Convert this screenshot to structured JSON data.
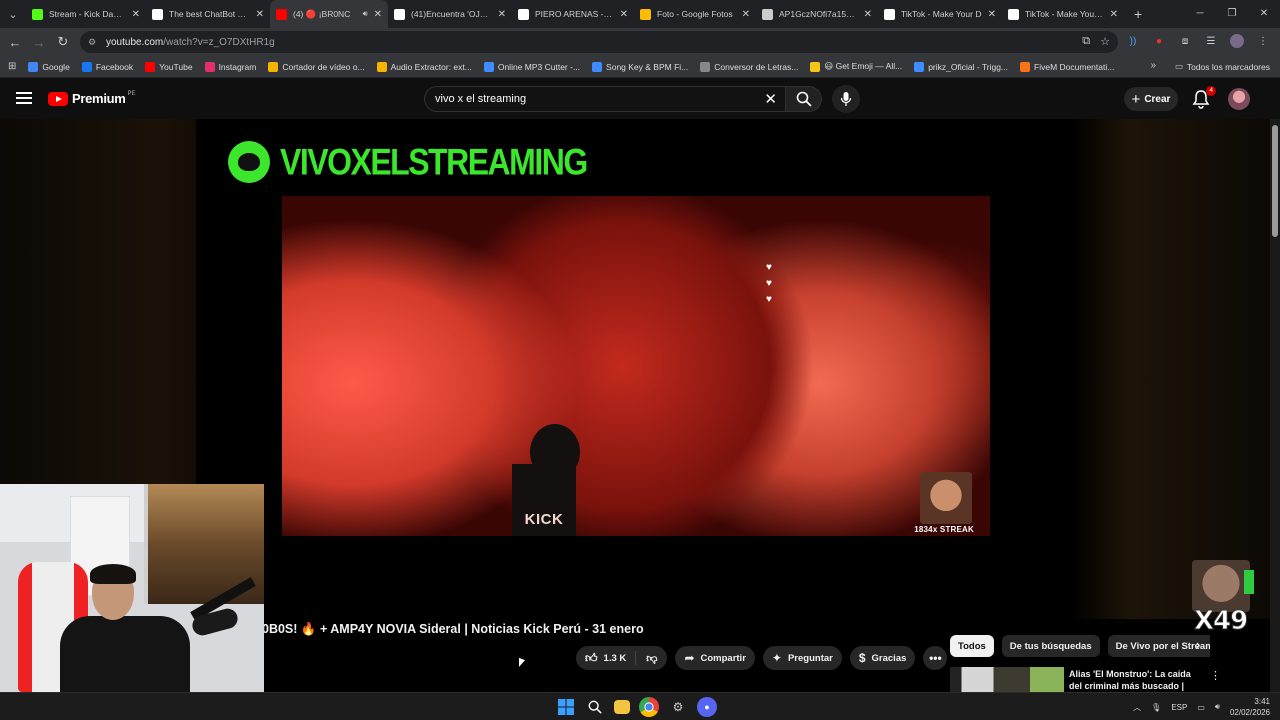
{
  "browser": {
    "tabs": [
      {
        "title": "Stream - Kick Dashboard",
        "icon": "kick-icon",
        "color": "#53fc18"
      },
      {
        "title": "The best ChatBot and",
        "icon": "chatbot-icon",
        "color": "#ffffff"
      },
      {
        "title": "(4) 🔴 ¡BR0NC",
        "icon": "youtube-icon",
        "color": "#ff0000",
        "active": true,
        "audio": true
      },
      {
        "title": "(41)Encuentra 'OJERA",
        "icon": "tiktok-icon",
        "color": "#ffffff"
      },
      {
        "title": "PIERO ARENAS - Bus",
        "icon": "google-icon",
        "color": "#ffffff"
      },
      {
        "title": "Foto - Google Fotos",
        "icon": "google-photos-icon",
        "color": "#fbbc05"
      },
      {
        "title": "AP1GczNOfi7a15uW",
        "icon": "globe-icon",
        "color": "#cccccc"
      },
      {
        "title": "TikTok - Make Your D",
        "icon": "tiktok-icon",
        "color": "#ffffff"
      },
      {
        "title": "TikTok - Make Your D",
        "icon": "tiktok-icon",
        "color": "#ffffff"
      }
    ],
    "url_host": "youtube.com",
    "url_path": "/watch?v=z_O7DXtHR1g",
    "bookmarks": [
      {
        "label": "Google",
        "icon": "google-icon",
        "color": "#4285f4"
      },
      {
        "label": "Facebook",
        "icon": "facebook-icon",
        "color": "#1877f2"
      },
      {
        "label": "YouTube",
        "icon": "youtube-icon",
        "color": "#ff0000"
      },
      {
        "label": "Instagram",
        "icon": "instagram-icon",
        "color": "#e1306c"
      },
      {
        "label": "Cortador de vídeo o...",
        "icon": "scissors-icon",
        "color": "#f4b400"
      },
      {
        "label": "Audio Extractor: ext...",
        "icon": "audio-icon",
        "color": "#f4b400"
      },
      {
        "label": "Online MP3 Cutter -...",
        "icon": "mp3-icon",
        "color": "#3f8cff"
      },
      {
        "label": "Song Key & BPM Fi...",
        "icon": "music-icon",
        "color": "#3f8cff"
      },
      {
        "label": "Conversor de Letras...",
        "icon": "text-icon",
        "color": "#888888"
      },
      {
        "label": "😃 Get Emoji — All...",
        "icon": "emoji-icon",
        "color": "#f5c518"
      },
      {
        "label": "prikz_Oficial - Trigg...",
        "icon": "trigger-icon",
        "color": "#3f8cff"
      },
      {
        "label": "FiveM Documentati...",
        "icon": "fivem-icon",
        "color": "#f97316"
      }
    ],
    "bookmarks_all": "Todos los marcadores"
  },
  "youtube": {
    "logo_text": "Premium",
    "country_code": "PE",
    "search_query": "vivo x el streaming",
    "create_label": "Crear",
    "notifications_count": "4",
    "channel_name_in_video": "VIVOXELSTREAMING",
    "mic_flag_text": "KICK",
    "streak_text": "1834x STREAK",
    "video_title": "0B0S! 🔥 + AMP4Y NOVIA Sideral | Noticias Kick Perú - 31 enero",
    "likes": "1.3 K",
    "share_label": "Compartir",
    "ask_label": "Preguntar",
    "thanks_label": "Gracias",
    "chips": [
      {
        "label": "Todos",
        "active": true
      },
      {
        "label": "De tus búsquedas",
        "active": false
      },
      {
        "label": "De Vivo por el Streaming",
        "active": false
      }
    ],
    "recommendation_title": "Alias 'El Monstruo': La caída del criminal más buscado | Cuarto"
  },
  "overlay": {
    "reaction_multiplier": "X49"
  },
  "taskbar": {
    "language": "ESP",
    "time": "3:41",
    "date": "02/02/2026"
  }
}
